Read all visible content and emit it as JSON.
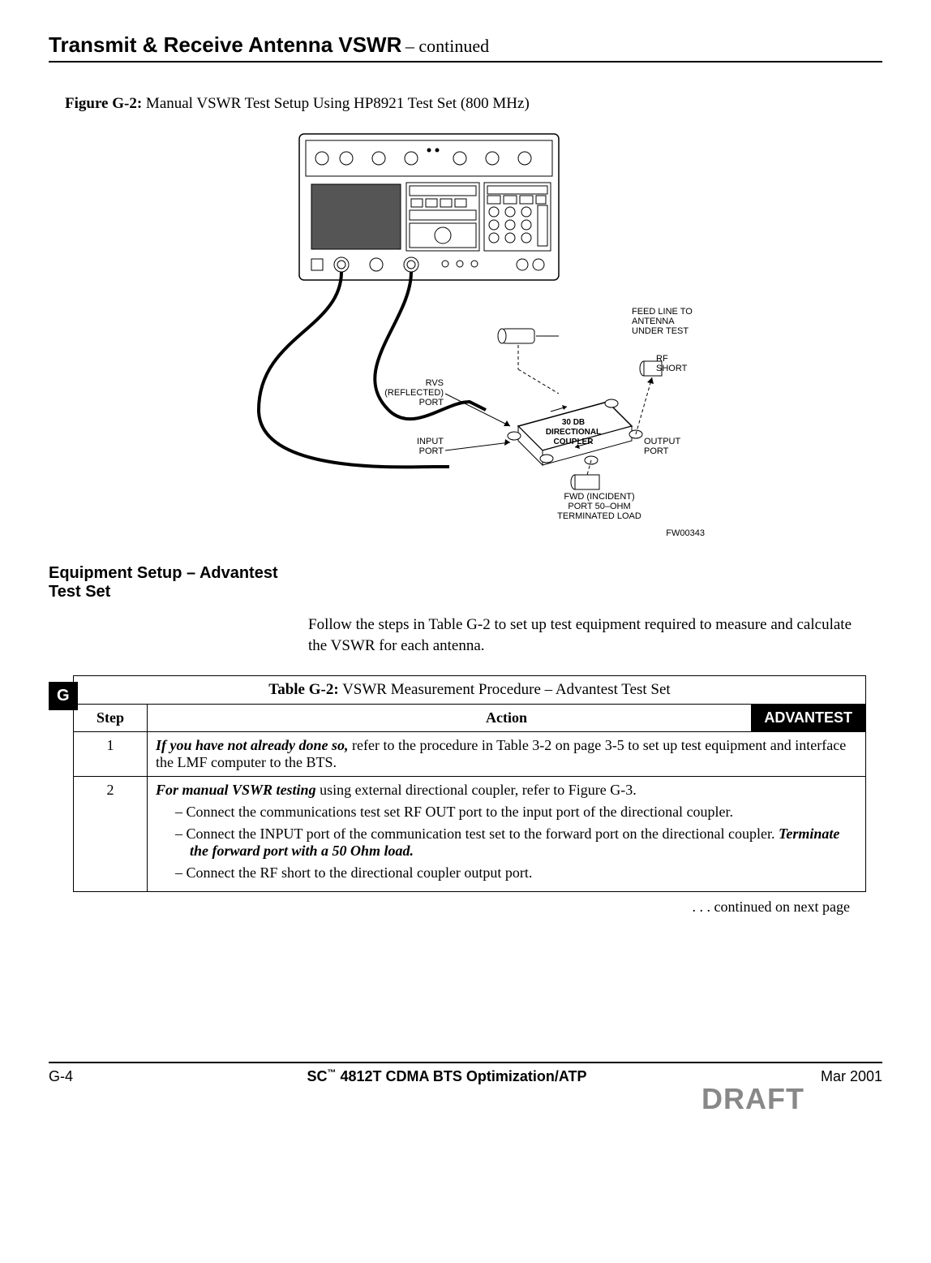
{
  "header": {
    "title": "Transmit & Receive Antenna VSWR",
    "continued": " – continued"
  },
  "figure": {
    "label": "Figure G-2:",
    "caption": " Manual VSWR Test Setup Using HP8921 Test Set (800 MHz)",
    "labels": {
      "feed_line": "FEED LINE TO ANTENNA UNDER TEST",
      "rf_short": "RF SHORT",
      "rvs_port": "RVS (REFLECTED) PORT",
      "coupler": "30 DB DIRECTIONAL COUPLER",
      "input_port": "INPUT PORT",
      "output_port": "OUTPUT PORT",
      "fwd_port": "FWD (INCIDENT) PORT 50–OHM TERMINATED LOAD",
      "fw_code": "FW00343"
    }
  },
  "section": {
    "heading": "Equipment Setup – Advantest Test Set",
    "para": "Follow the steps in Table G-2 to set up test equipment required to measure and calculate the VSWR for each antenna."
  },
  "g_tab": "G",
  "table": {
    "title_bold": "Table G-2:",
    "title_rest": " VSWR Measurement Procedure – Advantest Test Set",
    "head_step": "Step",
    "head_action": "Action",
    "badge": "ADVANTEST",
    "rows": [
      {
        "step": "1",
        "lead_bi": "If you have not already done so,",
        "lead_rest": " refer to the procedure in Table 3-2 on page 3-5 to set up test equipment and interface the LMF computer to the BTS."
      },
      {
        "step": "2",
        "lead_bi": "For manual VSWR testing",
        "lead_rest": " using external directional coupler, refer to Figure G-3.",
        "bullets": [
          "Connect the communications test set RF OUT port to the input port of the directional coupler.",
          "Connect the INPUT port of the communication test set to the forward port on the directional coupler. <em class=\"bi\">Terminate the forward port with a 50 Ohm load.</em>",
          "Connect the RF short to the directional coupler output port."
        ]
      }
    ],
    "continued": ". . . continued on next page"
  },
  "footer": {
    "left": "G-4",
    "center_pre": "SC",
    "center_tm": "™",
    "center_post": "4812T CDMA BTS Optimization/ATP",
    "right": "Mar 2001",
    "draft": "DRAFT"
  }
}
